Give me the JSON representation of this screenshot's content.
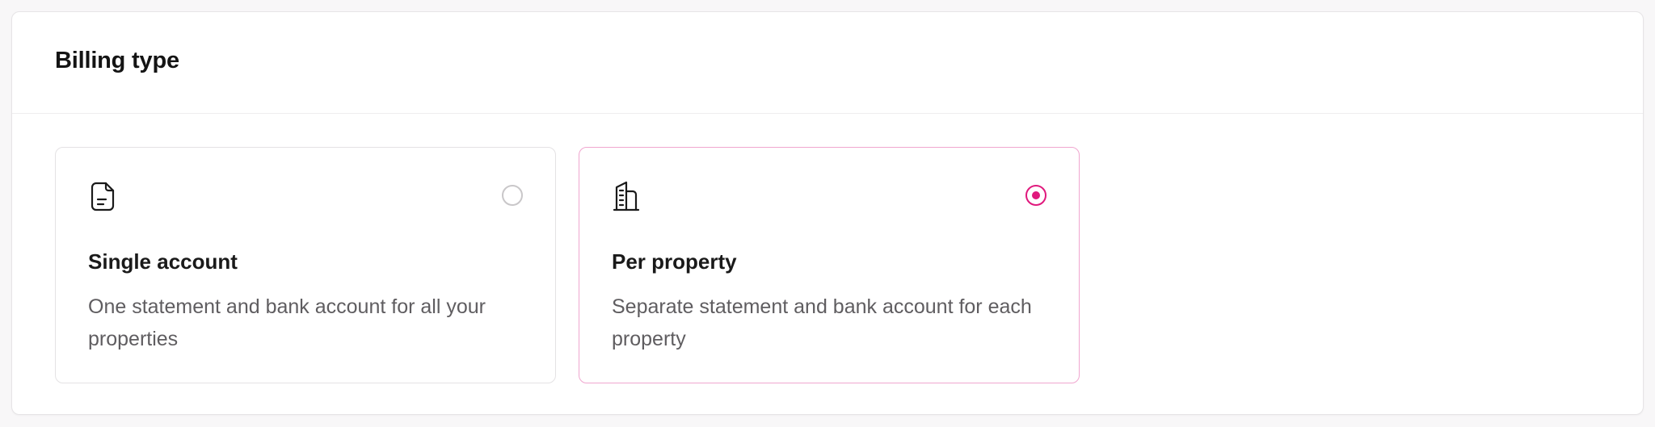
{
  "billing": {
    "title": "Billing type",
    "accent_color": "#e0197d",
    "options": [
      {
        "title": "Single account",
        "description": "One statement and bank account for all your properties",
        "icon": "document-icon",
        "selected": false
      },
      {
        "title": "Per property",
        "description": "Separate statement and bank account for each property",
        "icon": "building-icon",
        "selected": true
      }
    ]
  }
}
